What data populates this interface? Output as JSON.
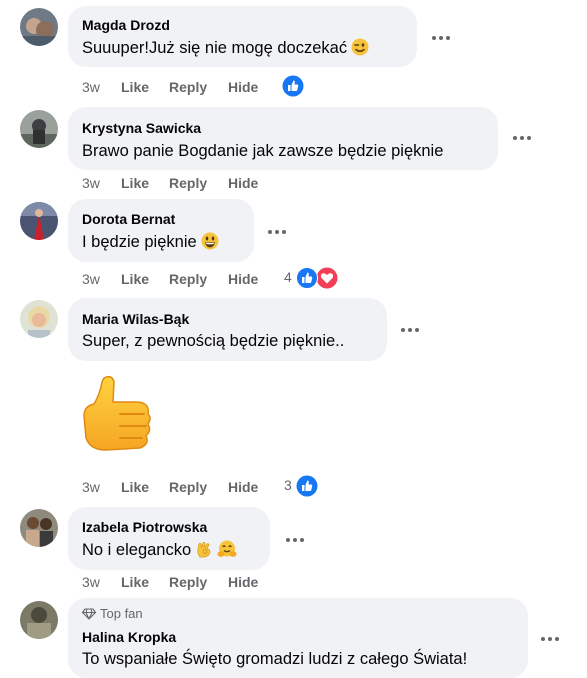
{
  "comments": [
    {
      "author": "Magda Drozd",
      "text": "Suuuper!Już się nie mogę doczekać",
      "emoji": "wink",
      "age": "3w",
      "like": "Like",
      "reply": "Reply",
      "hide": "Hide",
      "reaction_count": "",
      "reactions": [
        "like"
      ]
    },
    {
      "author": "Krystyna Sawicka",
      "text": "Brawo panie Bogdanie jak zawsze będzie pięknie",
      "age": "3w",
      "like": "Like",
      "reply": "Reply",
      "hide": "Hide"
    },
    {
      "author": "Dorota Bernat",
      "text": "I będzie pięknie",
      "emoji": "grin",
      "age": "3w",
      "like": "Like",
      "reply": "Reply",
      "hide": "Hide",
      "reaction_count": "4",
      "reactions": [
        "like",
        "love"
      ]
    },
    {
      "author": "Maria Wilas-Bąk",
      "text": "Super, z pewnością będzie pięknie..",
      "sticker": "thumbs-up",
      "age": "3w",
      "like": "Like",
      "reply": "Reply",
      "hide": "Hide",
      "reaction_count": "3",
      "reactions": [
        "like"
      ]
    },
    {
      "author": "Izabela Piotrowska",
      "text": "No i elegancko",
      "emoji": "ok-hand, hugging",
      "age": "3w",
      "like": "Like",
      "reply": "Reply",
      "hide": "Hide"
    },
    {
      "badge": "Top fan",
      "author": "Halina Kropka",
      "text": "To wspaniałe Święto gromadzi ludzi z całego Świata!"
    }
  ],
  "colors": {
    "bubble": "#f0f2f5",
    "meta": "#65676b",
    "like_blue": "#1877f2",
    "love_red": "#f33e58"
  }
}
